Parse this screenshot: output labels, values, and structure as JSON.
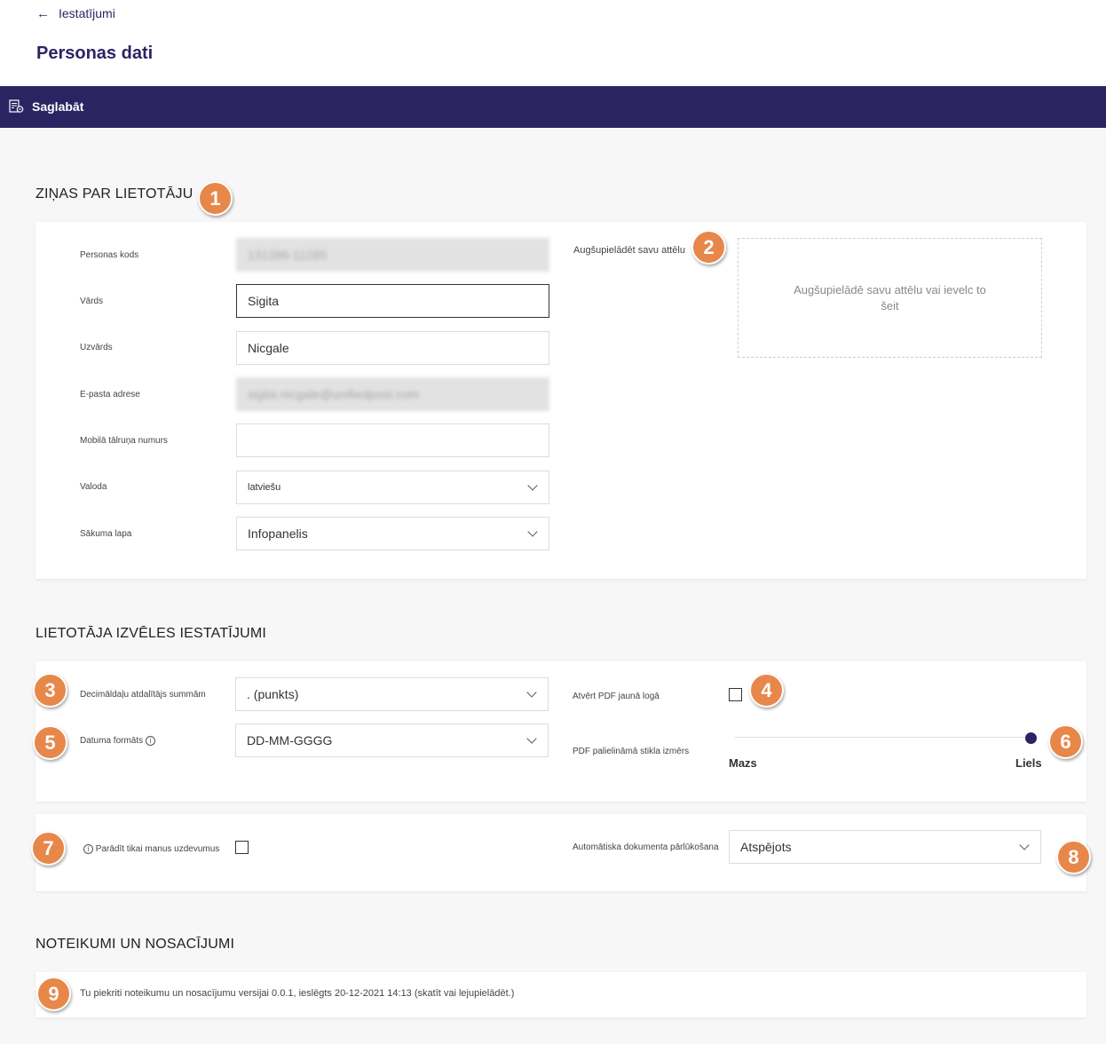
{
  "nav": {
    "back_label": "Iestatījumi"
  },
  "page": {
    "title": "Personas dati"
  },
  "toolbar": {
    "save_label": "Saglabāt"
  },
  "sections": {
    "user_info": "ZIŅAS PAR LIETOTĀJU",
    "preferences": "LIETOTĀJA IZVĒLES IESTATĪJUMI",
    "terms": "NOTEIKUMI UN NOSACĪJUMI"
  },
  "user_info": {
    "personal_code": {
      "label": "Personas kods",
      "value": "131286-11285"
    },
    "first_name": {
      "label": "Vārds",
      "value": "Sigita"
    },
    "last_name": {
      "label": "Uzvārds",
      "value": "Nicgale"
    },
    "email": {
      "label": "E-pasta adrese",
      "value": "sigita.nicgale@unifiedpost.com"
    },
    "mobile": {
      "label": "Mobilā tālruņa numurs",
      "value": ""
    },
    "language": {
      "label": "Valoda",
      "value": "latviešu"
    },
    "start_page": {
      "label": "Sākuma lapa",
      "value": "Infopanelis"
    },
    "upload": {
      "label": "Augšupielādēt savu attēlu",
      "dropzone_text": "Augšupielādē savu attēlu vai ievelc to šeit"
    }
  },
  "preferences": {
    "decimal_separator": {
      "label": "Decimāldaļu atdalītājs summām",
      "value": ". (punkts)"
    },
    "date_format": {
      "label": "Datuma formāts",
      "value": "DD-MM-GGGG"
    },
    "open_pdf_new_window": {
      "label": "Atvērt PDF jaunā logā",
      "checked": false
    },
    "magnifier_size": {
      "label": "PDF palielināmā stikla izmērs",
      "min_label": "Mazs",
      "max_label": "Liels",
      "value_fraction": 1.0
    },
    "show_my_tasks": {
      "label": "Parādīt tikai manus uzdevumus",
      "checked": false
    },
    "auto_browse": {
      "label": "Automātiska dokumenta pārlūkošana",
      "value": "Atspējots"
    }
  },
  "terms": {
    "text": "Tu piekriti noteikumu un nosacījumu versijai 0.0.1, ieslēgts 20-12-2021 14:13 (skatīt vai lejupielādēt.)"
  },
  "badges": [
    "1",
    "2",
    "3",
    "4",
    "5",
    "6",
    "7",
    "8",
    "9"
  ],
  "colors": {
    "brand": "#2b2463",
    "badge": "#e8874a",
    "background": "#f7f7f7"
  },
  "icons": {
    "back": "arrow-left-icon",
    "save": "save-document-icon",
    "info": "info-icon",
    "chevron": "chevron-down-icon"
  }
}
